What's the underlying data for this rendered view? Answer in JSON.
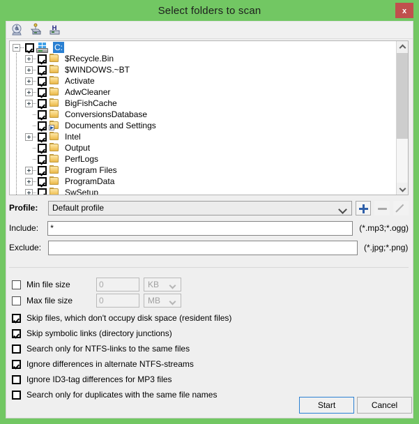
{
  "window": {
    "title": "Select folders to scan",
    "close_label": "x",
    "accent_green": "#72c763",
    "close_red": "#c0504d"
  },
  "toolbar": {
    "icons": [
      {
        "name": "scan-disk-icon",
        "title": "Scan disk"
      },
      {
        "name": "network-drive-icon",
        "title": "Network drive"
      },
      {
        "name": "hard-drive-icon",
        "title": "Hard drive"
      }
    ]
  },
  "tree": {
    "root": {
      "label": "C:",
      "checked": true,
      "expanded": true,
      "selected": true
    },
    "nodes": [
      {
        "label": "$Recycle.Bin",
        "checked": true,
        "expandable": true,
        "shortcut": false
      },
      {
        "label": "$WINDOWS.~BT",
        "checked": true,
        "expandable": true,
        "shortcut": false
      },
      {
        "label": "Activate",
        "checked": true,
        "expandable": true,
        "shortcut": false
      },
      {
        "label": "AdwCleaner",
        "checked": true,
        "expandable": true,
        "shortcut": false
      },
      {
        "label": "BigFishCache",
        "checked": true,
        "expandable": true,
        "shortcut": false
      },
      {
        "label": "ConversionsDatabase",
        "checked": true,
        "expandable": false,
        "shortcut": false
      },
      {
        "label": "Documents and Settings",
        "checked": true,
        "expandable": false,
        "shortcut": true
      },
      {
        "label": "Intel",
        "checked": true,
        "expandable": true,
        "shortcut": false
      },
      {
        "label": "Output",
        "checked": true,
        "expandable": false,
        "shortcut": false
      },
      {
        "label": "PerfLogs",
        "checked": true,
        "expandable": false,
        "shortcut": false
      },
      {
        "label": "Program Files",
        "checked": true,
        "expandable": true,
        "shortcut": false
      },
      {
        "label": "ProgramData",
        "checked": true,
        "expandable": true,
        "shortcut": false
      },
      {
        "label": "SwSetup",
        "checked": true,
        "expandable": true,
        "shortcut": false
      }
    ]
  },
  "profile": {
    "label": "Profile:",
    "selected": "Default profile",
    "add_title": "+",
    "remove_title": "-",
    "edit_title": "Edit"
  },
  "include": {
    "label": "Include:",
    "value": "*",
    "hint": "(*.mp3;*.ogg)"
  },
  "exclude": {
    "label": "Exclude:",
    "value": "",
    "hint": "(*.jpg;*.png)"
  },
  "size_filters": [
    {
      "label": "Min file size",
      "checked": false,
      "value": "0",
      "unit": "KB"
    },
    {
      "label": "Max file size",
      "checked": false,
      "value": "0",
      "unit": "MB"
    }
  ],
  "options": [
    {
      "label": "Skip files, which don't occupy disk space (resident files)",
      "checked": true
    },
    {
      "label": "Skip symbolic links (directory junctions)",
      "checked": true
    },
    {
      "label": "Search only for NTFS-links to the same files",
      "checked": false
    },
    {
      "label": "Ignore differences in alternate NTFS-streams",
      "checked": true
    },
    {
      "label": "Ignore ID3-tag differences for MP3 files",
      "checked": false
    },
    {
      "label": "Search only for duplicates with the same file names",
      "checked": false
    }
  ],
  "buttons": {
    "start": "Start",
    "cancel": "Cancel"
  }
}
